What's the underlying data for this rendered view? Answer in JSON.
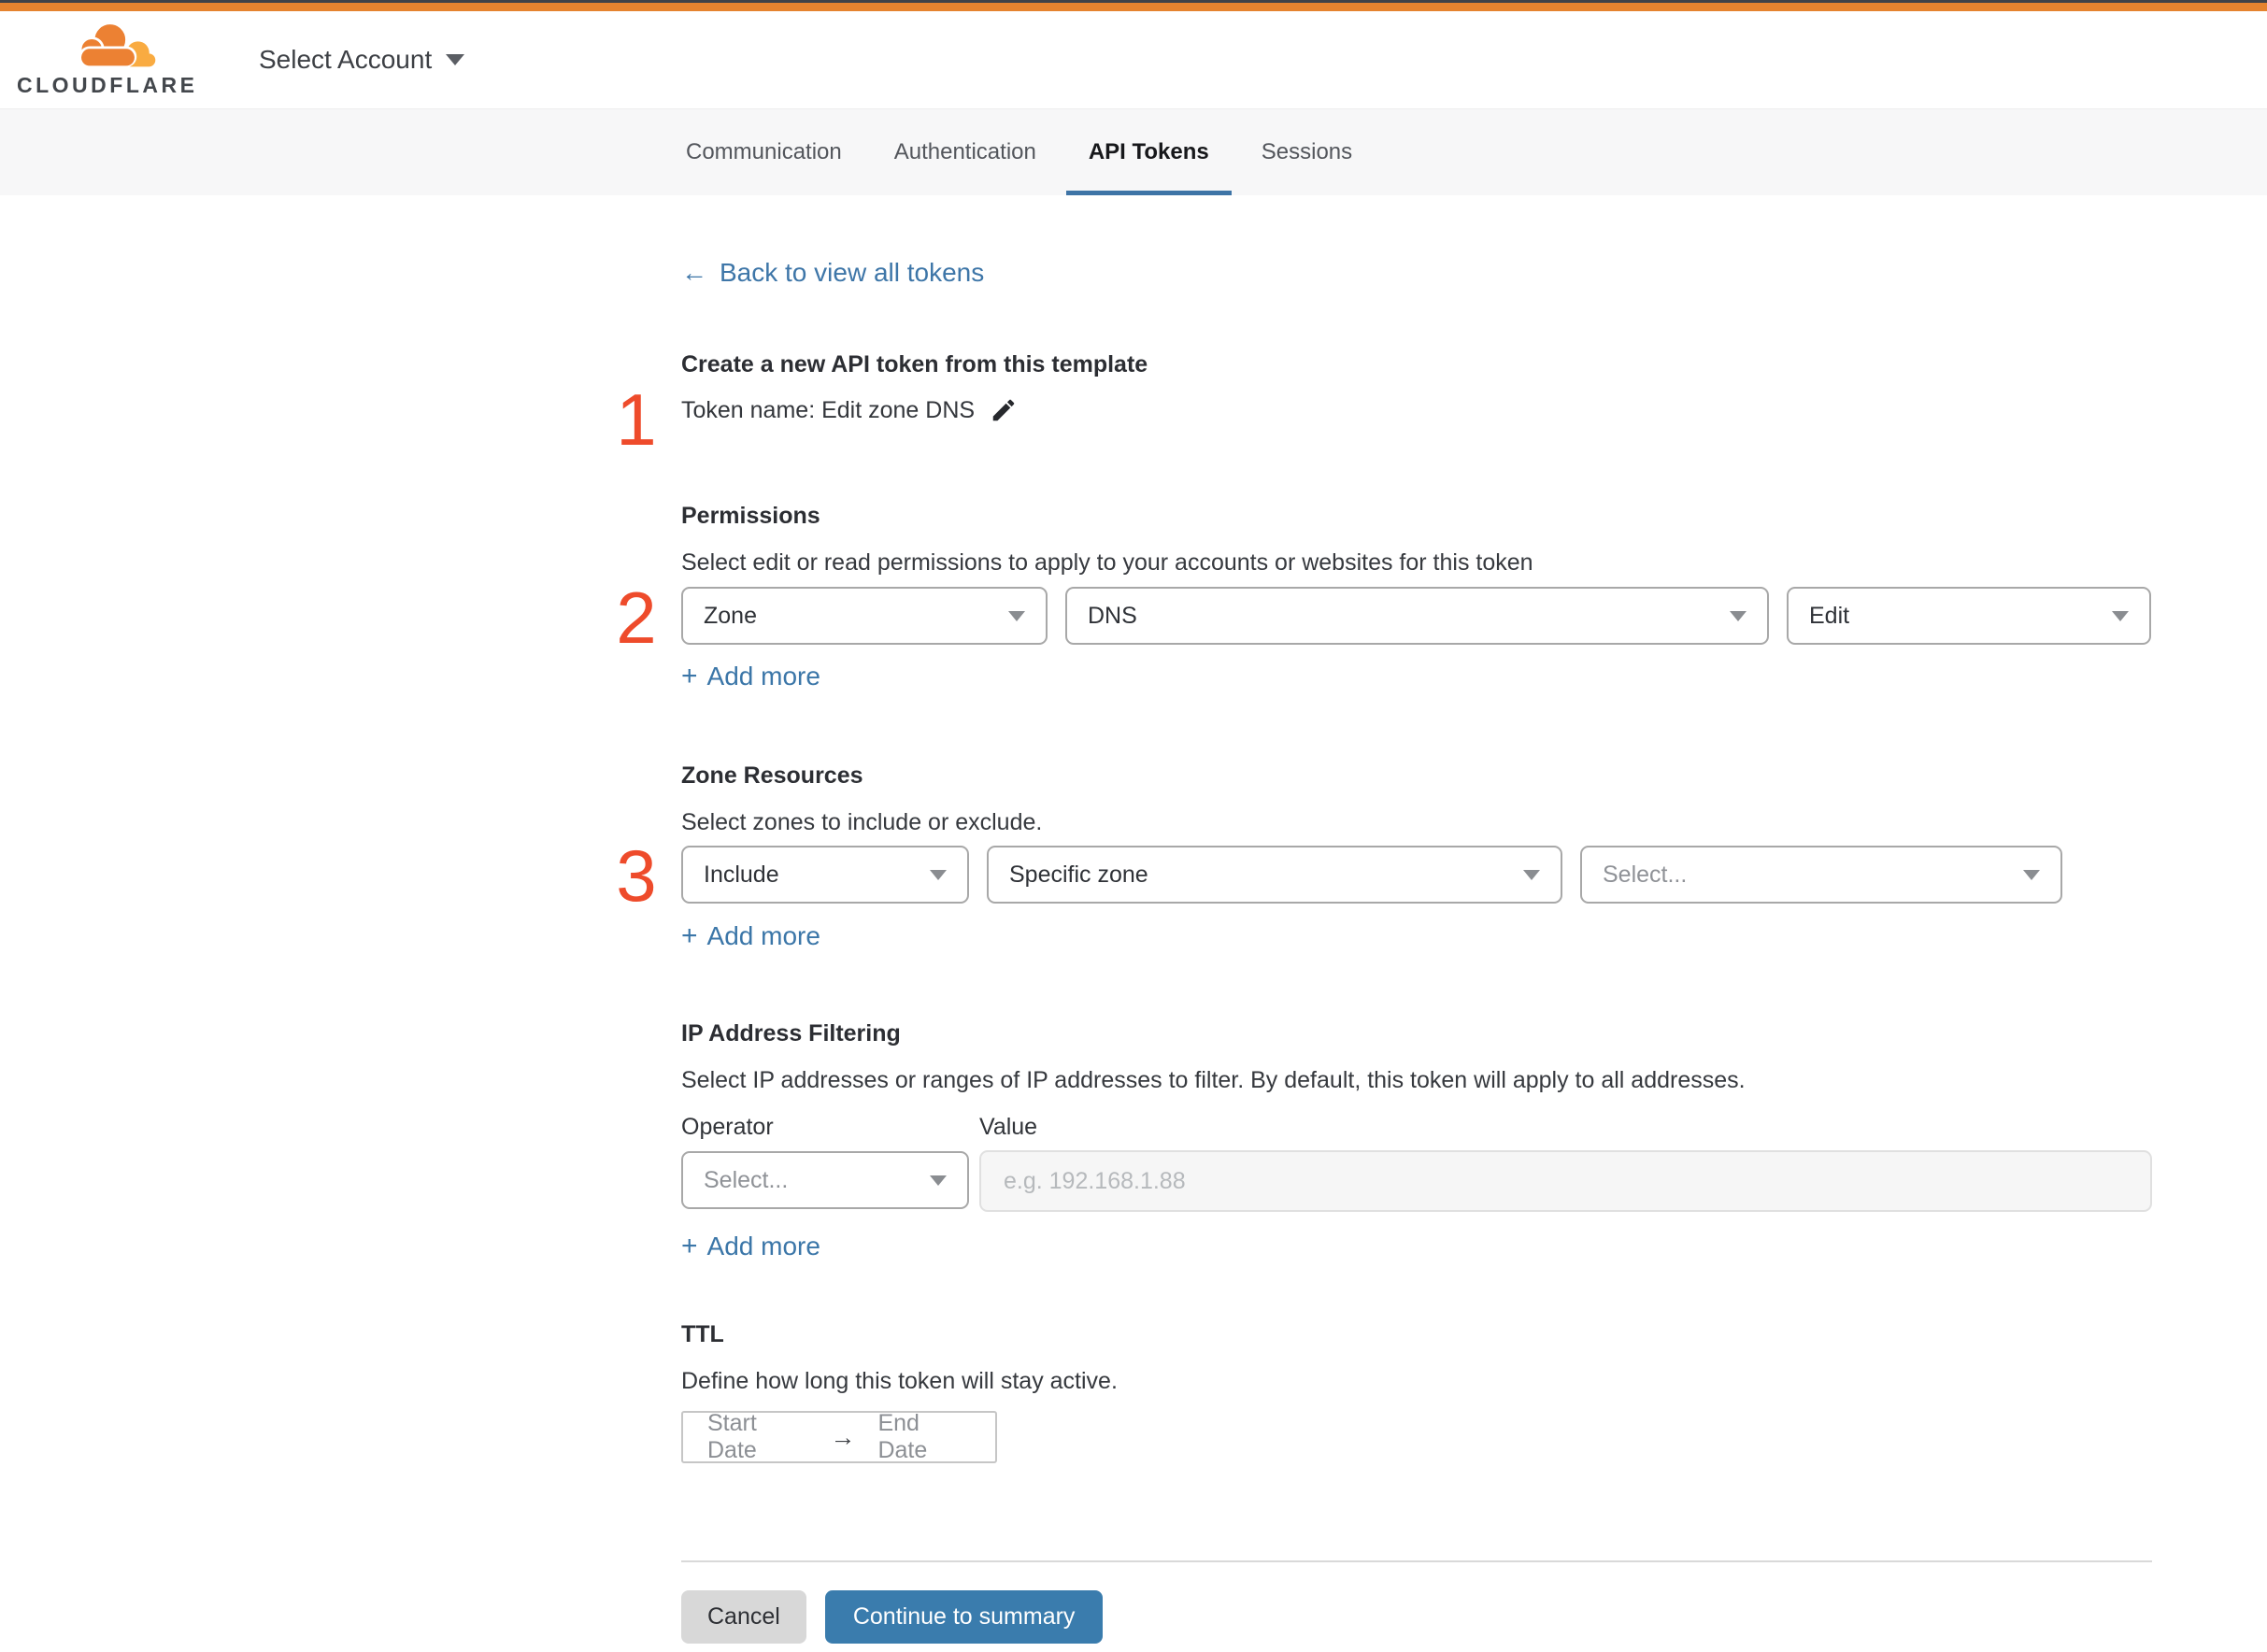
{
  "brand": {
    "name": "CLOUDFLARE"
  },
  "header": {
    "account_selector": "Select Account"
  },
  "tabs": [
    {
      "label": "Communication"
    },
    {
      "label": "Authentication"
    },
    {
      "label": "API Tokens"
    },
    {
      "label": "Sessions"
    }
  ],
  "icons": {
    "back_arrow": "←",
    "plus": "+",
    "range_arrow": "→"
  },
  "annotations": {
    "step_one": "1",
    "step_two": "2",
    "step_three": "3"
  },
  "back_link": {
    "label": "Back to view all tokens"
  },
  "token_section": {
    "heading": "Create a new API token from this template",
    "token_name": "Token name: Edit zone DNS"
  },
  "permissions": {
    "heading": "Permissions",
    "description": "Select edit or read permissions to apply to your accounts or websites for this token",
    "scope_value": "Zone",
    "service_value": "DNS",
    "access_value": "Edit",
    "add_more": "Add more"
  },
  "zone_resources": {
    "heading": "Zone Resources",
    "description": "Select zones to include or exclude.",
    "mode_value": "Include",
    "type_value": "Specific zone",
    "zone_placeholder": "Select...",
    "add_more": "Add more"
  },
  "ip_filtering": {
    "heading": "IP Address Filtering",
    "description": "Select IP addresses or ranges of IP addresses to filter. By default, this token will apply to all addresses.",
    "operator_label": "Operator",
    "value_label": "Value",
    "operator_placeholder": "Select...",
    "value_placeholder": "e.g. 192.168.1.88",
    "add_more": "Add more"
  },
  "ttl": {
    "heading": "TTL",
    "description": "Define how long this token will stay active.",
    "start_date_placeholder": "Start Date",
    "end_date_placeholder": "End Date"
  },
  "footer": {
    "cancel_label": "Cancel",
    "continue_label": "Continue to summary"
  },
  "colors": {
    "brand_orange": "#e5832f",
    "link_blue": "#3b76a8",
    "active_tab_underline": "#3e74a6",
    "primary_button_blue": "#3a7cad",
    "annotation_red": "#ee4b2b"
  }
}
